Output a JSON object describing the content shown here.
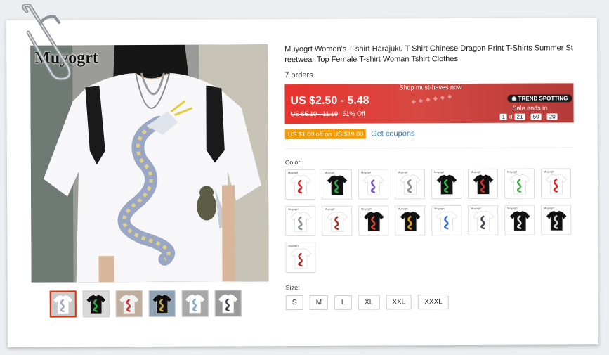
{
  "watermark": "Muyogrt",
  "product": {
    "title": "Muyogrt Women's T-shirt Harajuku T Shirt Chinese Dragon Print T-Shirts Summer Streetwear Top Female T-shirt Woman Tshirt Clothes",
    "orders": "7 orders"
  },
  "promo": {
    "tag": "Shop must-haves now",
    "price": "US $2.50 - 5.48",
    "original_price": "US $5.10 - 11.19",
    "discount": "51% Off",
    "badge": "TREND SPOTTING",
    "sale_ends_label": "Sale ends in",
    "timer": {
      "days": "1",
      "day_unit": "d",
      "hours": "21",
      "minutes": "50",
      "seconds": "20"
    },
    "colors": {
      "start": "#e8332e",
      "end": "#b23a38"
    }
  },
  "coupon": {
    "badge": "US $1.00 off on US $19.00",
    "link": "Get coupons"
  },
  "color_label": "Color:",
  "swatch_brand": "Muyogrt",
  "swatches": [
    {
      "shirt": "#ffffff",
      "print": "#d22b2b"
    },
    {
      "shirt": "#111111",
      "print": "#3aa14a"
    },
    {
      "shirt": "#ffffff",
      "print": "#7a5cc2"
    },
    {
      "shirt": "#ffffff",
      "print": "#8a8f98"
    },
    {
      "shirt": "#111111",
      "print": "#2fb24a"
    },
    {
      "shirt": "#111111",
      "print": "#d22b2b"
    },
    {
      "shirt": "#ffffff",
      "print": "#42b04f"
    },
    {
      "shirt": "#ffffff",
      "print": "#d22b2b"
    },
    {
      "shirt": "#ffffff",
      "print": "#8a8f98"
    },
    {
      "shirt": "#ffffff",
      "print": "#9a3b2e"
    },
    {
      "shirt": "#111111",
      "print": "#d9472b"
    },
    {
      "shirt": "#111111",
      "print": "#d9a11f"
    },
    {
      "shirt": "#ffffff",
      "print": "#3a6fd0"
    },
    {
      "shirt": "#ffffff",
      "print": "#444a55"
    },
    {
      "shirt": "#111111",
      "print": "#e8e8e8"
    },
    {
      "shirt": "#111111",
      "print": "#cfcfcf"
    },
    {
      "shirt": "#ffffff",
      "print": "#b0302a"
    }
  ],
  "thumbnails": [
    {
      "shirt": "#ffffff",
      "print": "#9aa7c4",
      "bg": "#c9c9c9",
      "active": true
    },
    {
      "shirt": "#111111",
      "print": "#2fb24a",
      "bg": "#d9d9d9",
      "active": false
    },
    {
      "shirt": "#f2f2f2",
      "print": "#d22b2b",
      "bg": "#bfae9e",
      "active": false
    },
    {
      "shirt": "#111111",
      "print": "#cfa640",
      "bg": "#8ea2b3",
      "active": false
    },
    {
      "shirt": "#ffffff",
      "print": "#7fa9c9",
      "bg": "#a8a8a8",
      "active": false
    },
    {
      "shirt": "#ffffff",
      "print": "#444a55",
      "bg": "#9a9a9a",
      "active": false
    }
  ],
  "size_label": "Size:",
  "sizes": [
    "S",
    "M",
    "L",
    "XL",
    "XXL",
    "XXXL"
  ]
}
